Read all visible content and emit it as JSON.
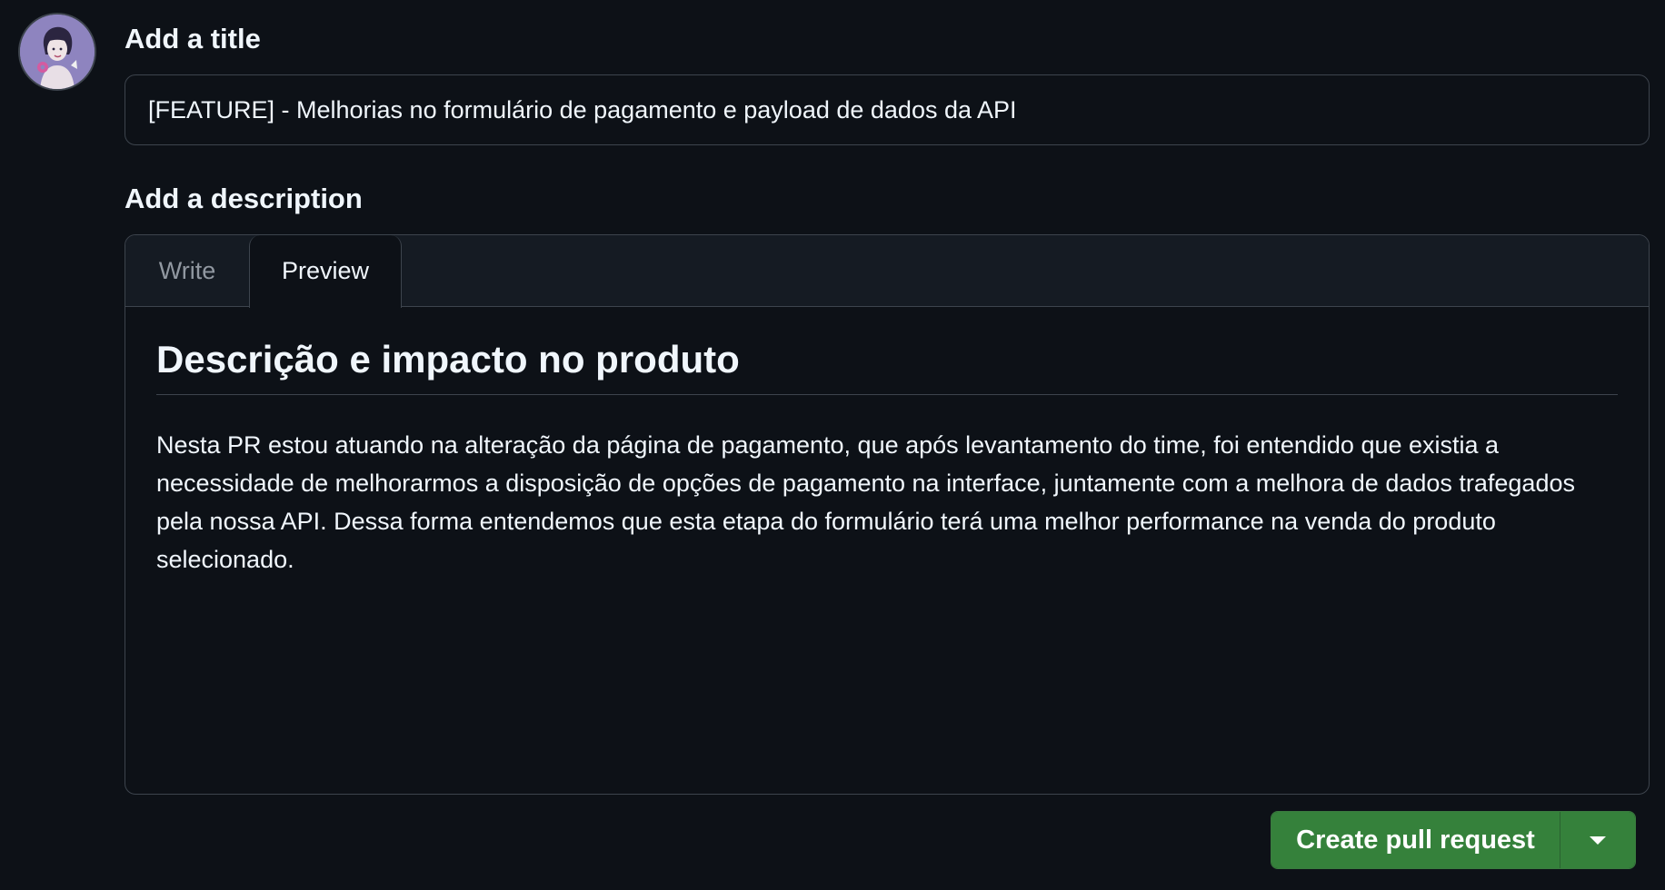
{
  "title_section": {
    "label": "Add a title",
    "value": "[FEATURE] - Melhorias no formulário de pagamento e payload de dados da API"
  },
  "description_section": {
    "label": "Add a description",
    "tabs": [
      {
        "label": "Write",
        "active": false
      },
      {
        "label": "Preview",
        "active": true
      }
    ],
    "preview": {
      "heading": "Descrição e impacto no produto",
      "body": "Nesta PR estou atuando na alteração da página de pagamento, que após levantamento do time, foi entendido que existia a necessidade de melhorarmos a disposição de opções de pagamento na interface, juntamente com a melhora de dados trafegados pela nossa API. Dessa forma entendemos que esta etapa do formulário terá uma melhor performance na venda do produto selecionado."
    }
  },
  "actions": {
    "create_label": "Create pull request",
    "dropdown_icon": "triangle-down-icon"
  },
  "colors": {
    "background": "#0d1117",
    "border": "#3d444d",
    "primary_button": "#35813b",
    "text": "#f0f6fc",
    "muted_text": "#9198a1"
  },
  "avatar": {
    "icon": "user-avatar"
  }
}
